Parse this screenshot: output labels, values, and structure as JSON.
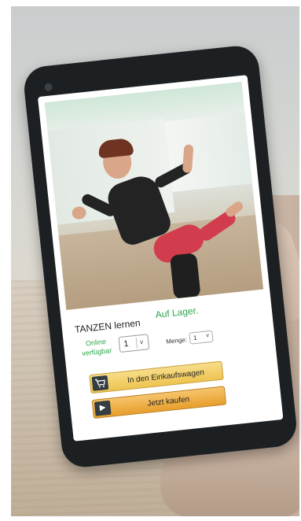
{
  "product": {
    "title": "TANZEN lernen",
    "stock_status": "Auf Lager.",
    "availability": "Online verfügbar",
    "quantity_value": "1",
    "menge_label": "Menge:",
    "menge_value": "1"
  },
  "buttons": {
    "add_to_cart": "In den Einkaufswagen",
    "buy_now": "Jetzt kaufen"
  },
  "icons": {
    "cart": "shopping-cart-icon",
    "play": "play-icon",
    "select_caret": "chevron-down-icon"
  },
  "colors": {
    "in_stock": "#2aa84a",
    "cart_button": "#eec44f",
    "buy_button": "#e79f2c",
    "pants": "#d23d4d"
  }
}
